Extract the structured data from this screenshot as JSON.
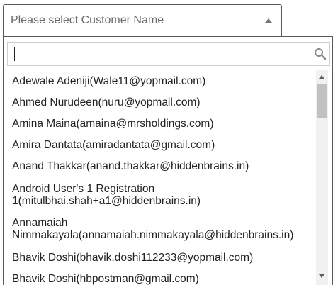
{
  "select": {
    "placeholder": "Please select Customer Name"
  },
  "search": {
    "value": ""
  },
  "options": [
    {
      "line1": "Adewale Adeniji(Wale11@yopmail.com)",
      "line2": ""
    },
    {
      "line1": "Ahmed Nurudeen(nuru@yopmail.com)",
      "line2": ""
    },
    {
      "line1": "Amina Maina(amaina@mrsholdings.com)",
      "line2": ""
    },
    {
      "line1": "Amira Dantata(amiradantata@gmail.com)",
      "line2": ""
    },
    {
      "line1": "Anand Thakkar(anand.thakkar@hiddenbrains.in)",
      "line2": ""
    },
    {
      "line1": "Android User's 1 Registration",
      "line2": "1(mitulbhai.shah+a1@hiddenbrains.in)"
    },
    {
      "line1": "Annamaiah",
      "line2": "Nimmakayala(annamaiah.nimmakayala@hiddenbrains.in)"
    },
    {
      "line1": "Bhavik Doshi(bhavik.doshi112233@yopmail.com)",
      "line2": ""
    },
    {
      "line1": "Bhavik Doshi(hbpostman@gmail.com)",
      "line2": ""
    }
  ],
  "icons": {
    "dropdown_arrow": "caret-up-icon",
    "search": "search-icon",
    "scroll_up": "scroll-up-arrow-icon",
    "scroll_down": "scroll-down-arrow-icon"
  }
}
